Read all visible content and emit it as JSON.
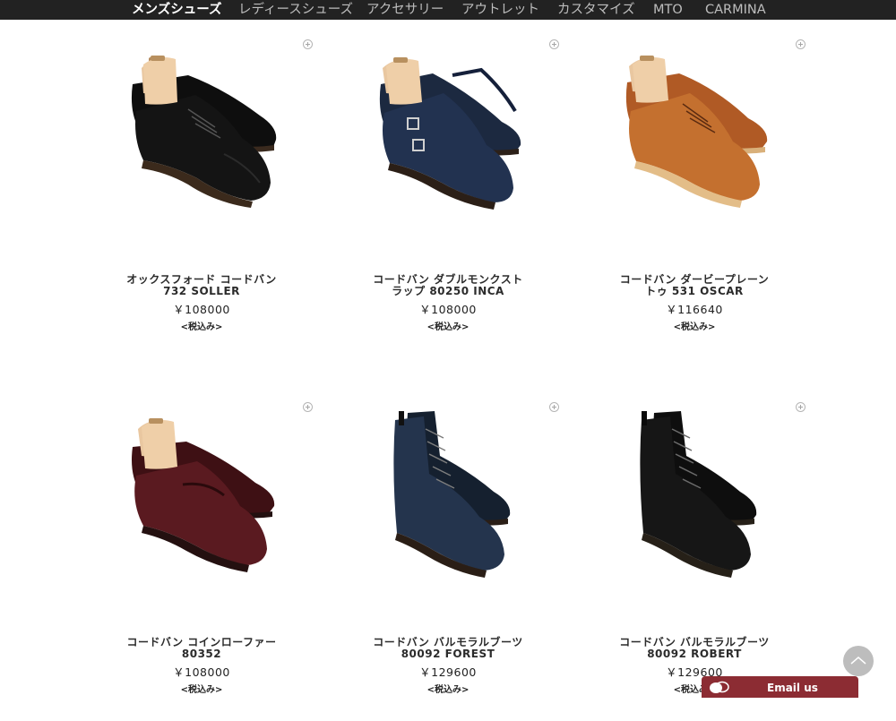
{
  "nav": {
    "items": [
      {
        "label": "メンズシューズ",
        "active": true
      },
      {
        "label": "レディースシューズ",
        "active": false
      },
      {
        "label": "アクセサリー",
        "active": false
      },
      {
        "label": "アウトレット",
        "active": false
      },
      {
        "label": "カスタマイズ",
        "active": false
      },
      {
        "label": "MTO",
        "active": false
      },
      {
        "label": "CARMINA",
        "active": false
      }
    ]
  },
  "products": [
    {
      "name_line1": "オックスフォード コードバン",
      "name_line2": "732 SOLLER",
      "price": "￥108000",
      "tax": "<税込み>",
      "style": "oxford",
      "color": "#121212"
    },
    {
      "name_line1": "コードバン ダブルモンクスト",
      "name_line2": "ラップ 80250 INCA",
      "price": "￥108000",
      "tax": "<税込み>",
      "style": "monk",
      "color": "#1f2b3f"
    },
    {
      "name_line1": "コードバン ダービープレーン",
      "name_line2": "トゥ 531 OSCAR",
      "price": "￥116640",
      "tax": "<税込み>",
      "style": "derby",
      "color": "#b4622d"
    },
    {
      "name_line1": "コードバン コインローファー",
      "name_line2": "80352",
      "price": "￥108000",
      "tax": "<税込み>",
      "style": "loafer",
      "color": "#4a1418"
    },
    {
      "name_line1": "コードバン バルモラルブーツ",
      "name_line2": "80092 FOREST",
      "price": "￥129600",
      "tax": "<税込み>",
      "style": "boot",
      "color": "#1e2a3c"
    },
    {
      "name_line1": "コードバン バルモラルブーツ",
      "name_line2": "80092 ROBERT",
      "price": "￥129600",
      "tax": "<税込み>",
      "style": "boot",
      "color": "#141414"
    }
  ],
  "widgets": {
    "email_label": "Email us",
    "email_color": "#8c2c33"
  }
}
